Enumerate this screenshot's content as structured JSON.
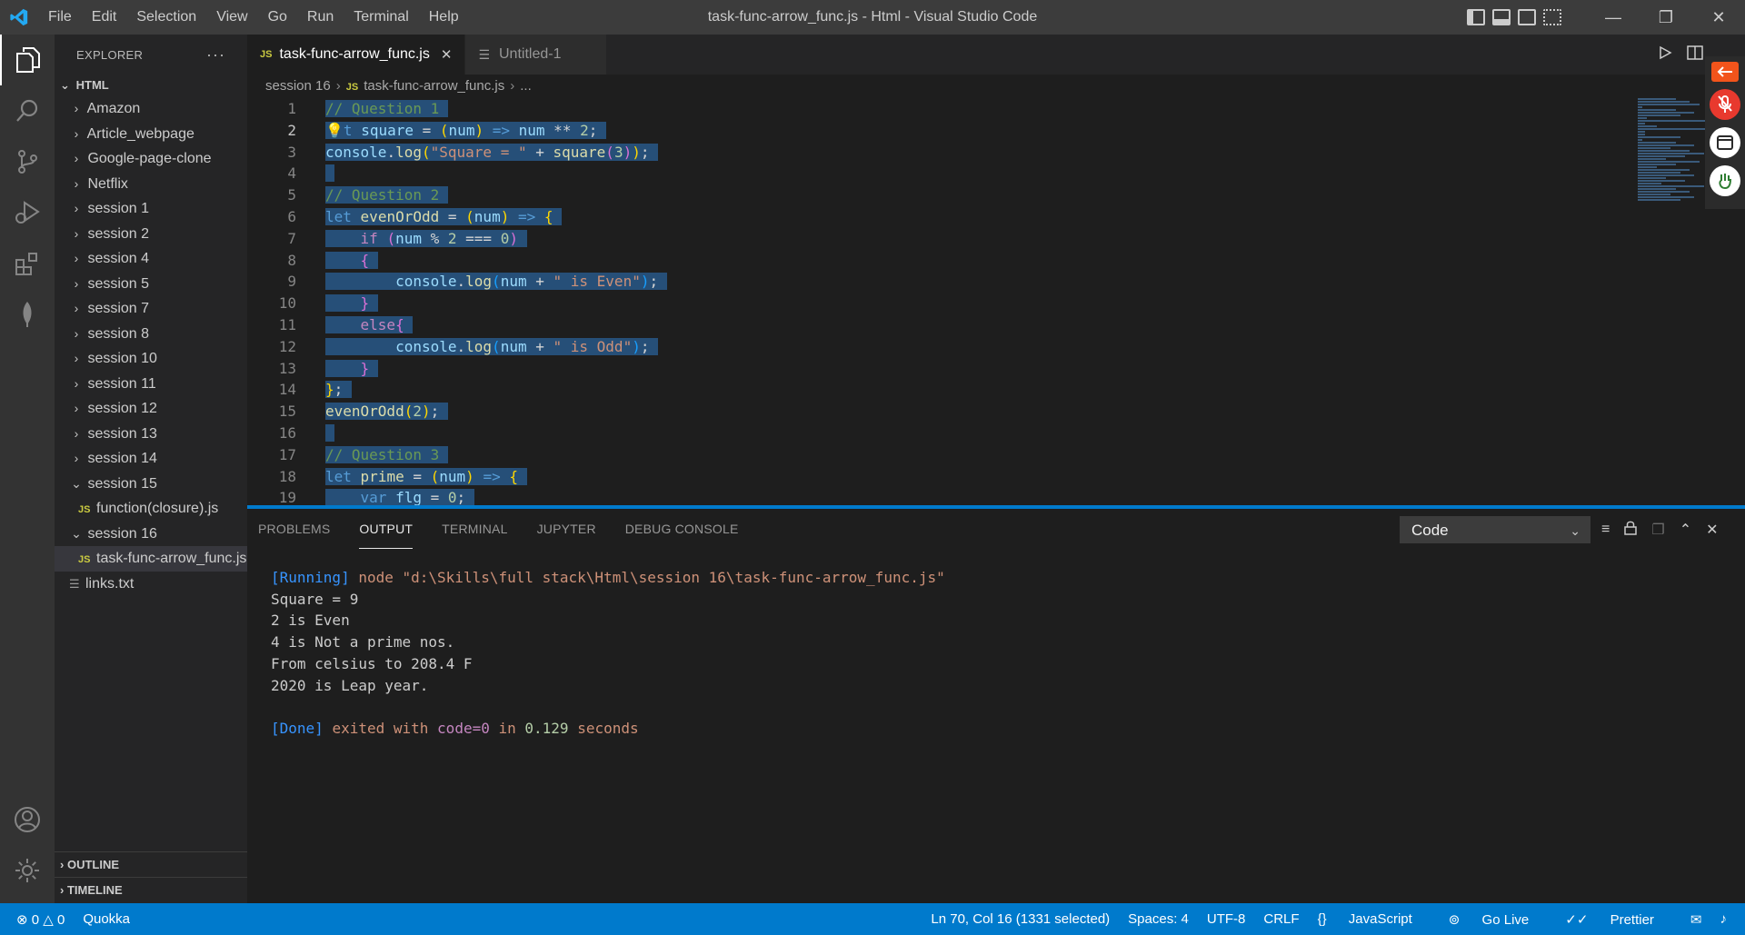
{
  "window": {
    "title": "task-func-arrow_func.js - Html - Visual Studio Code",
    "menu": [
      "File",
      "Edit",
      "Selection",
      "View",
      "Go",
      "Run",
      "Terminal",
      "Help"
    ]
  },
  "sidebar": {
    "header": "EXPLORER",
    "root": "HTML",
    "items": [
      {
        "label": "Amazon",
        "type": "folder",
        "expanded": false,
        "depth": 0
      },
      {
        "label": "Article_webpage",
        "type": "folder",
        "expanded": false,
        "depth": 0
      },
      {
        "label": "Google-page-clone",
        "type": "folder",
        "expanded": false,
        "depth": 0
      },
      {
        "label": "Netflix",
        "type": "folder",
        "expanded": false,
        "depth": 0
      },
      {
        "label": "session 1",
        "type": "folder",
        "expanded": false,
        "depth": 0
      },
      {
        "label": "session 2",
        "type": "folder",
        "expanded": false,
        "depth": 0
      },
      {
        "label": "session 4",
        "type": "folder",
        "expanded": false,
        "depth": 0
      },
      {
        "label": "session 5",
        "type": "folder",
        "expanded": false,
        "depth": 0
      },
      {
        "label": "session 7",
        "type": "folder",
        "expanded": false,
        "depth": 0
      },
      {
        "label": "session 8",
        "type": "folder",
        "expanded": false,
        "depth": 0
      },
      {
        "label": "session 10",
        "type": "folder",
        "expanded": false,
        "depth": 0
      },
      {
        "label": "session 11",
        "type": "folder",
        "expanded": false,
        "depth": 0
      },
      {
        "label": "session 12",
        "type": "folder",
        "expanded": false,
        "depth": 0
      },
      {
        "label": "session 13",
        "type": "folder",
        "expanded": false,
        "depth": 0
      },
      {
        "label": "session 14",
        "type": "folder",
        "expanded": false,
        "depth": 0
      },
      {
        "label": "session 15",
        "type": "folder",
        "expanded": true,
        "depth": 0
      },
      {
        "label": "function(closure).js",
        "type": "js",
        "depth": 1
      },
      {
        "label": "session 16",
        "type": "folder",
        "expanded": true,
        "depth": 0
      },
      {
        "label": "task-func-arrow_func.js",
        "type": "js",
        "depth": 1,
        "selected": true
      },
      {
        "label": "links.txt",
        "type": "txt",
        "depth": 0
      }
    ],
    "outline": "OUTLINE",
    "timeline": "TIMELINE"
  },
  "tabs": [
    {
      "label": "task-func-arrow_func.js",
      "badge": "JS",
      "active": true
    },
    {
      "label": "Untitled-1",
      "badge": "",
      "active": false
    }
  ],
  "breadcrumb": {
    "folder": "session 16",
    "badge": "JS",
    "file": "task-func-arrow_func.js",
    "more": "..."
  },
  "editor": {
    "lines": [
      {
        "n": "1",
        "tokens": [
          [
            "c-com",
            "// Question 1"
          ]
        ]
      },
      {
        "n": "2",
        "tokens": [
          [
            "bulb",
            "💡"
          ],
          [
            "c-kw",
            "t"
          ],
          [
            "",
            " "
          ],
          [
            "c-var",
            "square"
          ],
          [
            "",
            " = "
          ],
          [
            "c-br1",
            "("
          ],
          [
            "c-var",
            "num"
          ],
          [
            "c-br1",
            ")"
          ],
          [
            "",
            " "
          ],
          [
            "c-kw",
            "=>"
          ],
          [
            "",
            " "
          ],
          [
            "c-var",
            "num"
          ],
          [
            "",
            " ** "
          ],
          [
            "c-num",
            "2"
          ],
          [
            "",
            ";"
          ]
        ]
      },
      {
        "n": "3",
        "tokens": [
          [
            "c-var",
            "console"
          ],
          [
            "",
            "."
          ],
          [
            "c-fn",
            "log"
          ],
          [
            "c-br1",
            "("
          ],
          [
            "c-str",
            "\"Square = \""
          ],
          [
            "",
            " + "
          ],
          [
            "c-fn",
            "square"
          ],
          [
            "c-br2",
            "("
          ],
          [
            "c-num",
            "3"
          ],
          [
            "c-br2",
            ")"
          ],
          [
            "c-br1",
            ")"
          ],
          [
            "",
            ";"
          ]
        ]
      },
      {
        "n": "4",
        "tokens": [
          [
            "",
            ""
          ]
        ]
      },
      {
        "n": "5",
        "tokens": [
          [
            "c-com",
            "// Question 2"
          ]
        ]
      },
      {
        "n": "6",
        "tokens": [
          [
            "c-kw",
            "let"
          ],
          [
            "",
            " "
          ],
          [
            "c-fn",
            "evenOrOdd"
          ],
          [
            "",
            " = "
          ],
          [
            "c-br1",
            "("
          ],
          [
            "c-var",
            "num"
          ],
          [
            "c-br1",
            ")"
          ],
          [
            "",
            " "
          ],
          [
            "c-kw",
            "=>"
          ],
          [
            "",
            " "
          ],
          [
            "c-br1",
            "{"
          ]
        ]
      },
      {
        "n": "7",
        "tokens": [
          [
            "",
            "    "
          ],
          [
            "c-ctl",
            "if"
          ],
          [
            "",
            " "
          ],
          [
            "c-br2",
            "("
          ],
          [
            "c-var",
            "num"
          ],
          [
            "",
            " % "
          ],
          [
            "c-num",
            "2"
          ],
          [
            "",
            " === "
          ],
          [
            "c-num",
            "0"
          ],
          [
            "c-br2",
            ")"
          ]
        ]
      },
      {
        "n": "8",
        "tokens": [
          [
            "",
            "    "
          ],
          [
            "c-br2",
            "{"
          ]
        ]
      },
      {
        "n": "9",
        "tokens": [
          [
            "",
            "        "
          ],
          [
            "c-var",
            "console"
          ],
          [
            "",
            "."
          ],
          [
            "c-fn",
            "log"
          ],
          [
            "c-br3",
            "("
          ],
          [
            "c-var",
            "num"
          ],
          [
            "",
            " + "
          ],
          [
            "c-str",
            "\" is Even\""
          ],
          [
            "c-br3",
            ")"
          ],
          [
            "",
            ";"
          ]
        ]
      },
      {
        "n": "10",
        "tokens": [
          [
            "",
            "    "
          ],
          [
            "c-br2",
            "}"
          ]
        ]
      },
      {
        "n": "11",
        "tokens": [
          [
            "",
            "    "
          ],
          [
            "c-ctl",
            "else"
          ],
          [
            "c-br2",
            "{"
          ]
        ]
      },
      {
        "n": "12",
        "tokens": [
          [
            "",
            "        "
          ],
          [
            "c-var",
            "console"
          ],
          [
            "",
            "."
          ],
          [
            "c-fn",
            "log"
          ],
          [
            "c-br3",
            "("
          ],
          [
            "c-var",
            "num"
          ],
          [
            "",
            " + "
          ],
          [
            "c-str",
            "\" is Odd\""
          ],
          [
            "c-br3",
            ")"
          ],
          [
            "",
            ";"
          ]
        ]
      },
      {
        "n": "13",
        "tokens": [
          [
            "",
            "    "
          ],
          [
            "c-br2",
            "}"
          ]
        ]
      },
      {
        "n": "14",
        "tokens": [
          [
            "c-br1",
            "}"
          ],
          [
            "",
            ";"
          ]
        ]
      },
      {
        "n": "15",
        "tokens": [
          [
            "c-fn",
            "evenOrOdd"
          ],
          [
            "c-br1",
            "("
          ],
          [
            "c-num",
            "2"
          ],
          [
            "c-br1",
            ")"
          ],
          [
            "",
            ";"
          ]
        ]
      },
      {
        "n": "16",
        "tokens": [
          [
            "",
            ""
          ]
        ]
      },
      {
        "n": "17",
        "tokens": [
          [
            "c-com",
            "// Question 3"
          ]
        ]
      },
      {
        "n": "18",
        "tokens": [
          [
            "c-kw",
            "let"
          ],
          [
            "",
            " "
          ],
          [
            "c-fn",
            "prime"
          ],
          [
            "",
            " = "
          ],
          [
            "c-br1",
            "("
          ],
          [
            "c-var",
            "num"
          ],
          [
            "c-br1",
            ")"
          ],
          [
            "",
            " "
          ],
          [
            "c-kw",
            "=>"
          ],
          [
            "",
            " "
          ],
          [
            "c-br1",
            "{"
          ]
        ]
      },
      {
        "n": "19",
        "tokens": [
          [
            "",
            "    "
          ],
          [
            "c-kw",
            "var"
          ],
          [
            "",
            " "
          ],
          [
            "c-var",
            "flg"
          ],
          [
            "",
            " = "
          ],
          [
            "c-num",
            "0"
          ],
          [
            "",
            ";"
          ]
        ]
      }
    ]
  },
  "panel": {
    "tabs": [
      "PROBLEMS",
      "OUTPUT",
      "TERMINAL",
      "JUPYTER",
      "DEBUG CONSOLE"
    ],
    "active_tab": "OUTPUT",
    "dropdown_value": "Code",
    "output": {
      "running_tag": "[Running]",
      "running_cmd": "node \"d:\\Skills\\full stack\\Html\\session 16\\task-func-arrow_func.js\"",
      "lines": [
        "Square = 9",
        "2 is Even",
        "4 is Not a prime nos.",
        "From celsius to 208.4 F",
        "2020 is Leap year."
      ],
      "done_tag": "[Done]",
      "done_pre": "exited with",
      "done_code": "code=0",
      "done_in": "in",
      "done_time": "0.129",
      "done_unit": "seconds"
    }
  },
  "statusbar": {
    "errors": "0",
    "warnings": "0",
    "quokka": "Quokka",
    "position": "Ln 70, Col 16 (1331 selected)",
    "spaces": "Spaces: 4",
    "encoding": "UTF-8",
    "eol": "CRLF",
    "language": "JavaScript",
    "golive": "Go Live",
    "prettier": "Prettier"
  },
  "colors": {
    "accent": "#007acc",
    "selection": "#264f78",
    "activity_bar": "#333333",
    "sidebar": "#252526",
    "editor": "#1e1e1e"
  }
}
